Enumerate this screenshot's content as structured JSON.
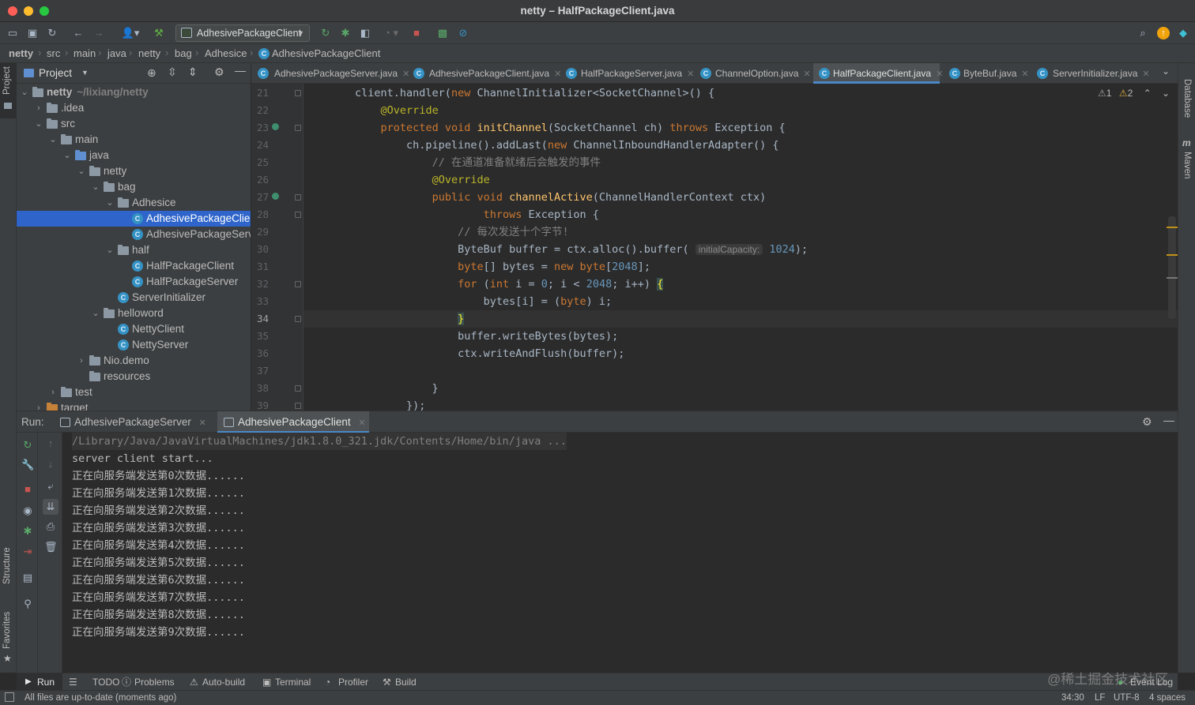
{
  "window": {
    "title": "netty – HalfPackageClient.java"
  },
  "colors": {
    "close": "#ff5f57",
    "minimize": "#febc2e",
    "zoom": "#28c840",
    "accent": "#2f65ca",
    "tab_underline": "#4a88c7"
  },
  "toolbar": {
    "run_config": "AdhesivePackageClient",
    "icons": [
      "open-folder-icon",
      "save-icon",
      "sync-icon",
      "back-icon",
      "forward-icon",
      "vcs-user-icon",
      "build-hammer-icon",
      "rerun-icon",
      "debug-bug-icon",
      "coverage-icon",
      "profile-icon",
      "stop-icon",
      "event-icon",
      "no-sign-icon",
      "search-icon",
      "update-icon",
      "plugin-icon"
    ]
  },
  "breadcrumb": [
    "netty",
    "src",
    "main",
    "java",
    "netty",
    "bag",
    "Adhesice",
    "AdhesivePackageClient"
  ],
  "left_strip": {
    "project": "Project",
    "structure": "Structure",
    "favorites": "Favorites"
  },
  "right_strip": {
    "database": "Database",
    "maven": "Maven"
  },
  "project": {
    "header": "Project",
    "tree": [
      {
        "label": "netty",
        "suffix": "~/lixiang/netty",
        "depth": 0,
        "type": "folder",
        "expanded": true
      },
      {
        "label": ".idea",
        "depth": 1,
        "type": "folder",
        "expanded": false
      },
      {
        "label": "src",
        "depth": 1,
        "type": "folder",
        "expanded": true
      },
      {
        "label": "main",
        "depth": 2,
        "type": "folder",
        "expanded": true
      },
      {
        "label": "java",
        "depth": 3,
        "type": "src",
        "expanded": true
      },
      {
        "label": "netty",
        "depth": 4,
        "type": "package",
        "expanded": true
      },
      {
        "label": "bag",
        "depth": 5,
        "type": "package",
        "expanded": true
      },
      {
        "label": "Adhesice",
        "depth": 6,
        "type": "package",
        "expanded": true
      },
      {
        "label": "AdhesivePackageClie",
        "depth": 7,
        "type": "class",
        "selected": true
      },
      {
        "label": "AdhesivePackageServ",
        "depth": 7,
        "type": "class"
      },
      {
        "label": "half",
        "depth": 6,
        "type": "package",
        "expanded": true
      },
      {
        "label": "HalfPackageClient",
        "depth": 7,
        "type": "class"
      },
      {
        "label": "HalfPackageServer",
        "depth": 7,
        "type": "class"
      },
      {
        "label": "ServerInitializer",
        "depth": 6,
        "type": "class"
      },
      {
        "label": "helloword",
        "depth": 5,
        "type": "package",
        "expanded": true
      },
      {
        "label": "NettyClient",
        "depth": 6,
        "type": "class"
      },
      {
        "label": "NettyServer",
        "depth": 6,
        "type": "class"
      },
      {
        "label": "Nio.demo",
        "depth": 4,
        "type": "package",
        "expanded": false
      },
      {
        "label": "resources",
        "depth": 4,
        "type": "folder"
      },
      {
        "label": "test",
        "depth": 2,
        "type": "folder",
        "expanded": false
      },
      {
        "label": "target",
        "depth": 1,
        "type": "orange",
        "expanded": false
      }
    ]
  },
  "editor_tabs": [
    {
      "label": "AdhesivePackageServer.java"
    },
    {
      "label": "AdhesivePackageClient.java"
    },
    {
      "label": "HalfPackageServer.java"
    },
    {
      "label": "ChannelOption.java"
    },
    {
      "label": "HalfPackageClient.java",
      "active": true
    },
    {
      "label": "ByteBuf.java"
    },
    {
      "label": "ServerInitializer.java"
    }
  ],
  "inspections": {
    "warnings": "1",
    "weak_warnings": "2"
  },
  "code": {
    "current_line": "34",
    "lines": [
      {
        "n": "21",
        "html": "        client.handler(<span class=\"kw\">new</span> ChannelInitializer&lt;SocketChannel&gt;() {"
      },
      {
        "n": "22",
        "html": "            <span class=\"ann\">@Override</span>"
      },
      {
        "n": "23",
        "html": "            <span class=\"kw\">protected void</span> <span class=\"fn\">initChannel</span>(SocketChannel ch) <span class=\"kw\">throws</span> Exception {"
      },
      {
        "n": "24",
        "html": "                ch.pipeline().addLast(<span class=\"kw\">new</span> ChannelInboundHandlerAdapter() {"
      },
      {
        "n": "25",
        "html": "                    <span class=\"cmt\">// 在通道准备就绪后会触发的事件</span>"
      },
      {
        "n": "26",
        "html": "                    <span class=\"ann\">@Override</span>"
      },
      {
        "n": "27",
        "html": "                    <span class=\"kw\">public void</span> <span class=\"fn\">channelActive</span>(ChannelHandlerContext ctx)"
      },
      {
        "n": "28",
        "html": "                            <span class=\"kw\">throws</span> Exception {"
      },
      {
        "n": "29",
        "html": "                        <span class=\"cmt\">// 每次发送十个字节!</span>"
      },
      {
        "n": "30",
        "html": "                        ByteBuf buffer = ctx.alloc().buffer( <span class=\"hint\">initialCapacity:</span> <span class=\"num\">1024</span>);"
      },
      {
        "n": "31",
        "html": "                        <span class=\"kw\">byte</span>[] bytes = <span class=\"kw\">new byte</span>[<span class=\"num\">2048</span>];"
      },
      {
        "n": "32",
        "html": "                        <span class=\"kw\">for</span> (<span class=\"kw\">int</span> i = <span class=\"num\">0</span>; i &lt; <span class=\"num\">2048</span>; i++) <span class=\"brace-hl\">{</span>"
      },
      {
        "n": "33",
        "html": "                            bytes[i] = (<span class=\"kw\">byte</span>) i;"
      },
      {
        "n": "34",
        "html": "                        <span class=\"brace-hl\">}</span>"
      },
      {
        "n": "35",
        "html": "                        buffer.writeBytes(bytes);"
      },
      {
        "n": "36",
        "html": "                        ctx.writeAndFlush(buffer);"
      },
      {
        "n": "37",
        "html": ""
      },
      {
        "n": "38",
        "html": "                    }"
      },
      {
        "n": "39",
        "html": "                });"
      }
    ]
  },
  "run_panel": {
    "label": "Run:",
    "tabs": [
      {
        "label": "AdhesivePackageServer"
      },
      {
        "label": "AdhesivePackageClient",
        "active": true
      }
    ],
    "console": [
      "/Library/Java/JavaVirtualMachines/jdk1.8.0_321.jdk/Contents/Home/bin/java ...",
      "server client start...",
      "正在向服务端发送第0次数据......",
      "正在向服务端发送第1次数据......",
      "正在向服务端发送第2次数据......",
      "正在向服务端发送第3次数据......",
      "正在向服务端发送第4次数据......",
      "正在向服务端发送第5次数据......",
      "正在向服务端发送第6次数据......",
      "正在向服务端发送第7次数据......",
      "正在向服务端发送第8次数据......",
      "正在向服务端发送第9次数据......"
    ]
  },
  "bottom_tabs": [
    {
      "label": "Run",
      "icon": "run-icon",
      "active": true
    },
    {
      "label": "TODO",
      "icon": "todo-icon"
    },
    {
      "label": "Problems",
      "icon": "problems-icon"
    },
    {
      "label": "Auto-build",
      "icon": "warning-icon"
    },
    {
      "label": "Terminal",
      "icon": "terminal-icon"
    },
    {
      "label": "Profiler",
      "icon": "profiler-icon"
    },
    {
      "label": "Build",
      "icon": "build-icon"
    }
  ],
  "status": {
    "message": "All files are up-to-date (moments ago)",
    "event_log": "Event Log",
    "position": "34:30",
    "line_sep": "LF",
    "encoding": "UTF-8",
    "indent": "4 spaces"
  },
  "watermark": "@稀土掘金技术社区"
}
